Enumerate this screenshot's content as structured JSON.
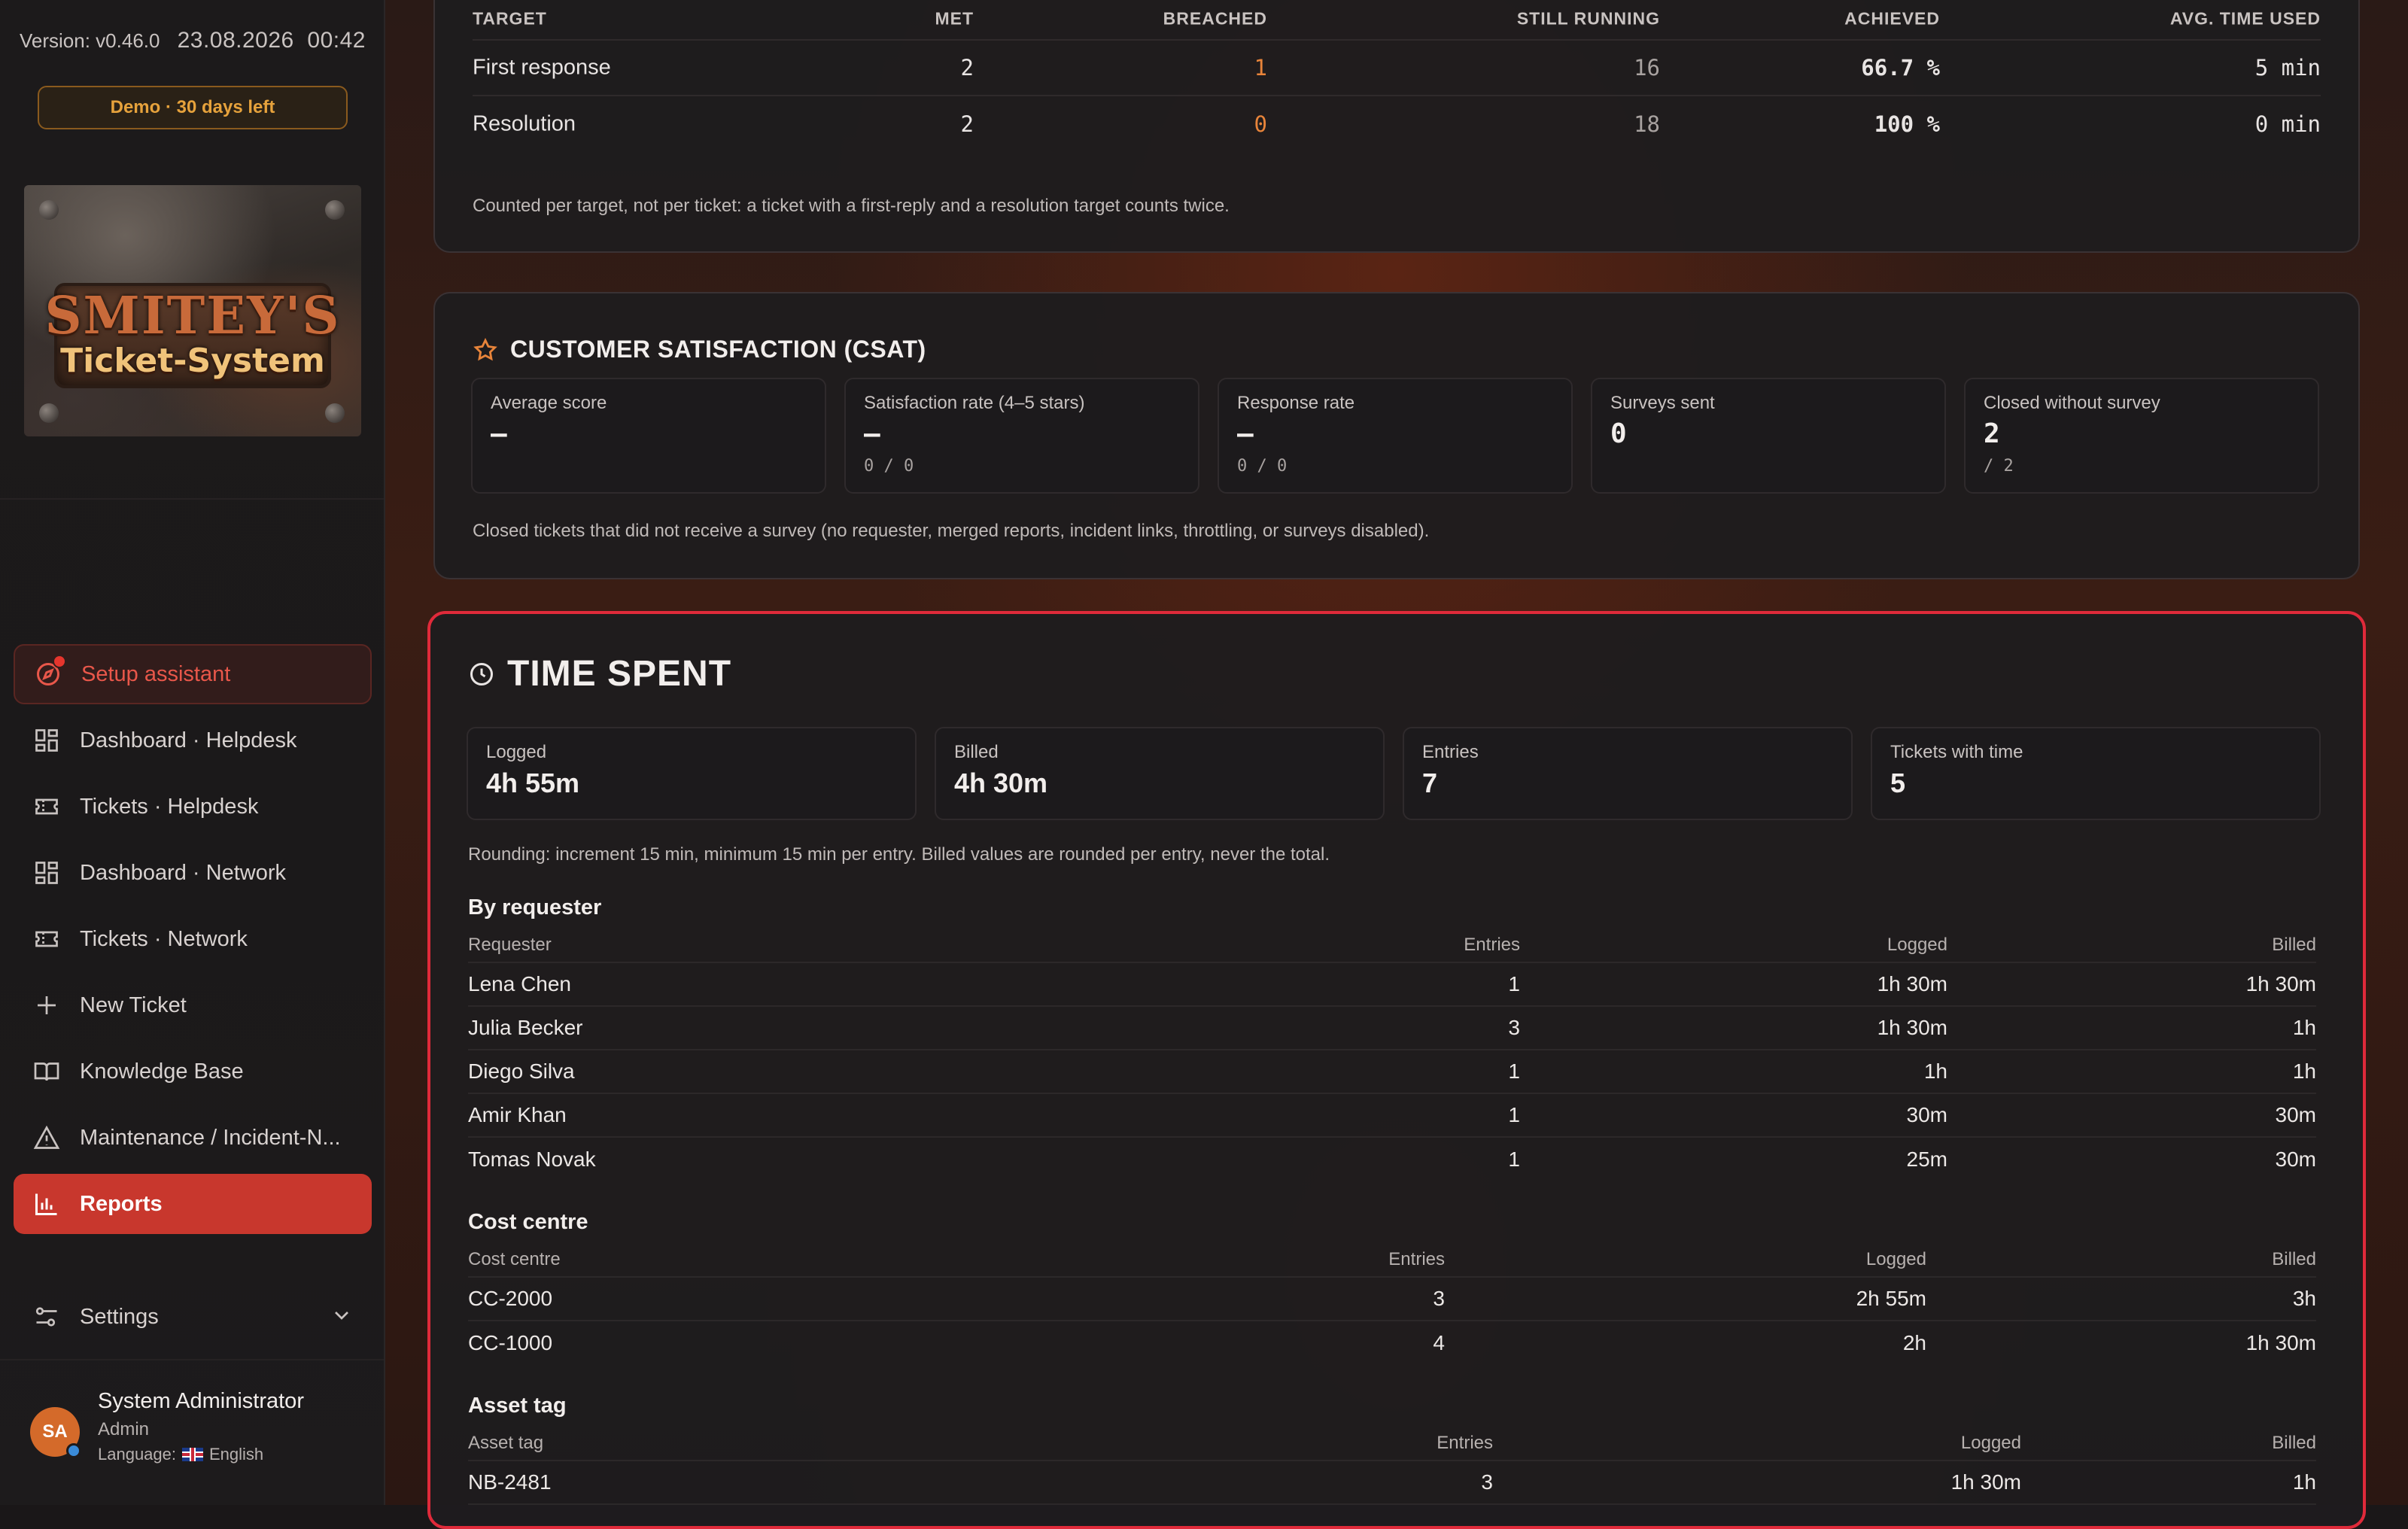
{
  "sidebar": {
    "version": "Version: v0.46.0",
    "date": "23.08.2026",
    "time": "00:42",
    "demo_badge": "Demo · 30 days left",
    "logo_line1": "SMITEY'S",
    "logo_line2": "Ticket-System",
    "nav": [
      {
        "label": "Setup assistant",
        "icon": "compass-icon"
      },
      {
        "label": "Dashboard · Helpdesk",
        "icon": "dashboard-icon"
      },
      {
        "label": "Tickets · Helpdesk",
        "icon": "ticket-icon"
      },
      {
        "label": "Dashboard · Network",
        "icon": "dashboard-icon"
      },
      {
        "label": "Tickets · Network",
        "icon": "ticket-icon"
      },
      {
        "label": "New Ticket",
        "icon": "plus-icon"
      },
      {
        "label": "Knowledge Base",
        "icon": "book-icon"
      },
      {
        "label": "Maintenance / Incident-N...",
        "icon": "warning-icon"
      },
      {
        "label": "Reports",
        "icon": "chart-icon"
      }
    ],
    "settings_label": "Settings",
    "user": {
      "initials": "SA",
      "name": "System Administrator",
      "role": "Admin",
      "language_label": "Language:",
      "language": "English"
    }
  },
  "sla": {
    "headers": [
      "TARGET",
      "MET",
      "BREACHED",
      "STILL RUNNING",
      "ACHIEVED",
      "AVG. TIME USED"
    ],
    "rows": [
      {
        "target": "First response",
        "met": "2",
        "breached": "1",
        "running": "16",
        "achieved": "66.7 %",
        "avg": "5 min"
      },
      {
        "target": "Resolution",
        "met": "2",
        "breached": "0",
        "running": "18",
        "achieved": "100 %",
        "avg": "0 min"
      }
    ],
    "note": "Counted per target, not per ticket: a ticket with a first-reply and a resolution target counts twice."
  },
  "csat": {
    "title": "CUSTOMER SATISFACTION (CSAT)",
    "stats": [
      {
        "label": "Average score",
        "value": "–",
        "sub": ""
      },
      {
        "label": "Satisfaction rate (4–5 stars)",
        "value": "–",
        "sub": "0 / 0"
      },
      {
        "label": "Response rate",
        "value": "–",
        "sub": "0 / 0"
      },
      {
        "label": "Surveys sent",
        "value": "0",
        "sub": ""
      },
      {
        "label": "Closed without survey",
        "value": "2",
        "sub": "/ 2"
      }
    ],
    "note": "Closed tickets that did not receive a survey (no requester, merged reports, incident links, throttling, or surveys disabled)."
  },
  "time_spent": {
    "title": "TIME SPENT",
    "stats": [
      {
        "label": "Logged",
        "value": "4h 55m"
      },
      {
        "label": "Billed",
        "value": "4h 30m"
      },
      {
        "label": "Entries",
        "value": "7"
      },
      {
        "label": "Tickets with time",
        "value": "5"
      }
    ],
    "rounding_note": "Rounding: increment 15 min, minimum 15 min per entry. Billed values are rounded per entry, never the total.",
    "by_requester": {
      "title": "By requester",
      "headers": [
        "Requester",
        "Entries",
        "Logged",
        "Billed"
      ],
      "rows": [
        [
          "Lena Chen",
          "1",
          "1h 30m",
          "1h 30m"
        ],
        [
          "Julia Becker",
          "3",
          "1h 30m",
          "1h"
        ],
        [
          "Diego Silva",
          "1",
          "1h",
          "1h"
        ],
        [
          "Amir Khan",
          "1",
          "30m",
          "30m"
        ],
        [
          "Tomas Novak",
          "1",
          "25m",
          "30m"
        ]
      ]
    },
    "cost_centre": {
      "title": "Cost centre",
      "headers": [
        "Cost centre",
        "Entries",
        "Logged",
        "Billed"
      ],
      "rows": [
        [
          "CC-2000",
          "3",
          "2h 55m",
          "3h"
        ],
        [
          "CC-1000",
          "4",
          "2h",
          "1h 30m"
        ]
      ]
    },
    "asset_tag": {
      "title": "Asset tag",
      "headers": [
        "Asset tag",
        "Entries",
        "Logged",
        "Billed"
      ],
      "rows": [
        [
          "NB-2481",
          "3",
          "1h 30m",
          "1h"
        ]
      ]
    }
  }
}
